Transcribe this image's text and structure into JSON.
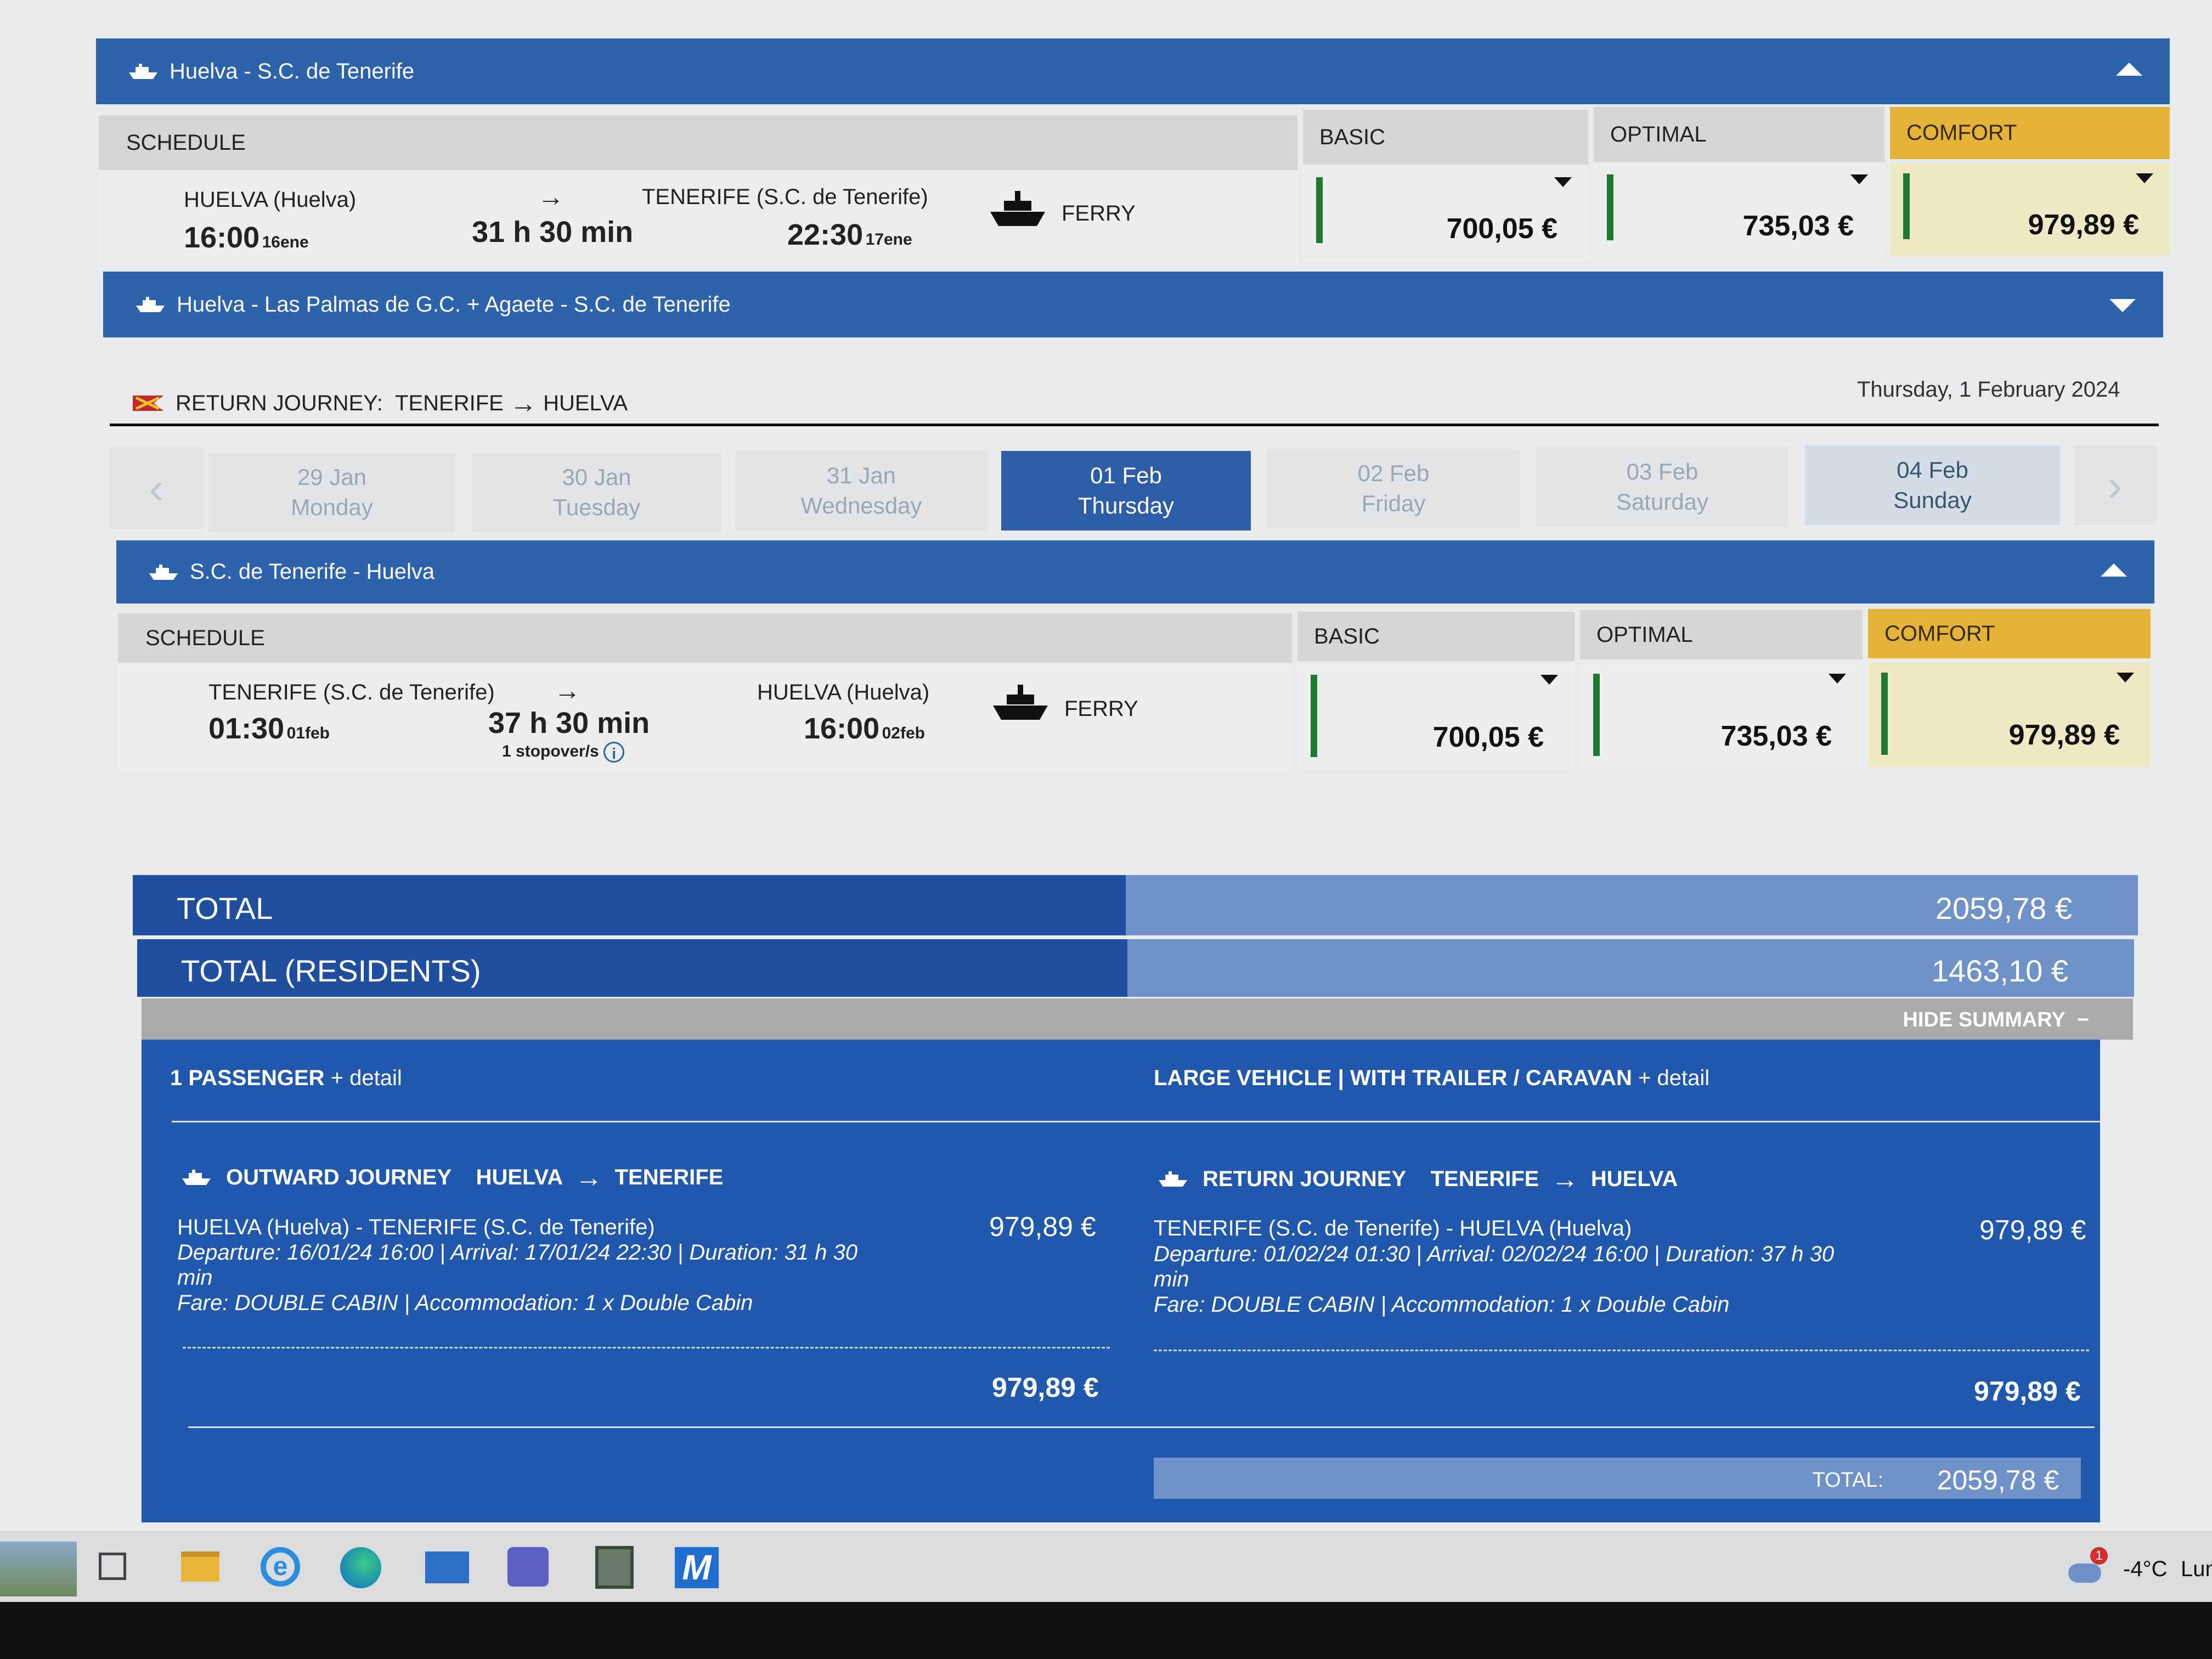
{
  "outward": {
    "route_bar": "Huelva - S.C. de Tenerife",
    "headers": {
      "schedule": "SCHEDULE",
      "basic": "BASIC",
      "optimal": "OPTIMAL",
      "comfort": "COMFORT"
    },
    "dep_place": "HUELVA (Huelva)",
    "dep_time": "16:00",
    "dep_day": "16ene",
    "arrow": "→",
    "duration": "31 h 30 min",
    "arr_place": "TENERIFE (S.C. de Tenerife)",
    "arr_time": "22:30",
    "arr_day": "17ene",
    "vessel": "FERRY",
    "price_basic": "700,05 €",
    "price_optimal": "735,03 €",
    "price_comfort": "979,89 €"
  },
  "alt_route": "Huelva - Las Palmas de G.C. + Agaete - S.C. de Tenerife",
  "return_header": {
    "label": "RETURN JOURNEY:",
    "from": "TENERIFE",
    "arrow": "→",
    "to": "HUELVA",
    "date": "Thursday, 1 February 2024"
  },
  "dates": [
    {
      "date": "29 Jan",
      "day": "Monday"
    },
    {
      "date": "30 Jan",
      "day": "Tuesday"
    },
    {
      "date": "31 Jan",
      "day": "Wednesday"
    },
    {
      "date": "01 Feb",
      "day": "Thursday"
    },
    {
      "date": "02 Feb",
      "day": "Friday"
    },
    {
      "date": "03 Feb",
      "day": "Saturday"
    },
    {
      "date": "04 Feb",
      "day": "Sunday"
    }
  ],
  "return": {
    "route_bar": "S.C. de Tenerife - Huelva",
    "headers": {
      "schedule": "SCHEDULE",
      "basic": "BASIC",
      "optimal": "OPTIMAL",
      "comfort": "COMFORT"
    },
    "dep_place": "TENERIFE (S.C. de Tenerife)",
    "dep_time": "01:30",
    "dep_day": "01feb",
    "arrow": "→",
    "duration": "37 h 30 min",
    "stopovers": "1 stopover/s",
    "arr_place": "HUELVA (Huelva)",
    "arr_time": "16:00",
    "arr_day": "02feb",
    "vessel": "FERRY",
    "price_basic": "700,05 €",
    "price_optimal": "735,03 €",
    "price_comfort": "979,89 €"
  },
  "totals": {
    "total_label": "TOTAL",
    "total_value": "2059,78 €",
    "residents_label": "TOTAL (RESIDENTS)",
    "residents_value": "1463,10 €",
    "hide_summary": "HIDE SUMMARY"
  },
  "summary": {
    "passenger": "1 PASSENGER",
    "passenger_detail": "+ detail",
    "vehicle": "LARGE VEHICLE | WITH TRAILER / CARAVAN",
    "vehicle_detail": "+ detail",
    "outward": {
      "title": "OUTWARD JOURNEY",
      "from": "HUELVA",
      "arrow": "→",
      "to": "TENERIFE",
      "route": "HUELVA (Huelva) - TENERIFE (S.C. de Tenerife)",
      "price": "979,89 €",
      "details_1": "Departure: 16/01/24 16:00 | Arrival: 17/01/24 22:30 | Duration: 31 h 30",
      "details_2": "min",
      "fare": "Fare: DOUBLE CABIN | Accommodation: 1 x Double Cabin",
      "subtotal": "979,89 €"
    },
    "return": {
      "title": "RETURN JOURNEY",
      "from": "TENERIFE",
      "arrow": "→",
      "to": "HUELVA",
      "route": "TENERIFE (S.C. de Tenerife) - HUELVA (Huelva)",
      "price": "979,89 €",
      "details_1": "Departure: 01/02/24 01:30 | Arrival: 02/02/24 16:00 | Duration: 37 h 30",
      "details_2": "min",
      "fare": "Fare: DOUBLE CABIN | Accommodation: 1 x Double Cabin",
      "subtotal": "979,89 €"
    },
    "grand_label": "TOTAL:",
    "grand_value": "2059,78 €"
  },
  "taskbar": {
    "weather": "-4°C",
    "day": "Lun",
    "badge": "1",
    "mail_app_letter": "M"
  },
  "colors": {
    "brand_blue": "#2d63ad",
    "summary_blue": "#1f58ad",
    "comfort_gold": "#e4b43a",
    "availability_green": "#1e7a2e"
  }
}
